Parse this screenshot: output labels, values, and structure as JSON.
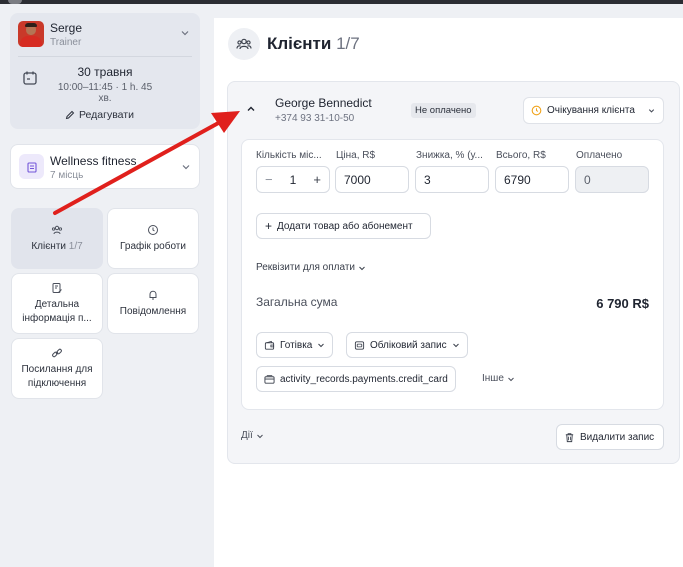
{
  "trainer": {
    "name": "Serge",
    "role": "Trainer",
    "date": "30 травня",
    "time": "10:00–11:45 · 1 h. 45 хв.",
    "edit_label": "Редагувати"
  },
  "gym": {
    "name": "Wellness fitness",
    "capacity": "7 місць"
  },
  "nav": {
    "clients_label": "Клієнти",
    "clients_count": "1/7",
    "schedule_label": "Графік роботи",
    "details_label_1": "Детальна",
    "details_label_2": "інформація п...",
    "notifications_label": "Повідомлення",
    "link_label_1": "Посилання для",
    "link_label_2": "підключення"
  },
  "page": {
    "title": "Клієнти",
    "count": "1/7"
  },
  "client": {
    "name": "George Bennedict",
    "phone": "+374 93 31-10-50",
    "payment_badge": "Не оплачено",
    "status": "Очікування клієнта",
    "columns": {
      "quantity": "Кількість міс...",
      "price": "Ціна, R$",
      "discount": "Знижка, % (у...",
      "total": "Всього, R$",
      "paid": "Оплачено"
    },
    "quantity": "1",
    "price": "7000",
    "discount": "3",
    "line_total": "6790",
    "paid": "0",
    "add_item_label": "Додати товар або абонемент",
    "requisites_label": "Реквізити для оплати",
    "grand_total_label": "Загальна сума",
    "grand_total_value": "6 790 R$",
    "payment_methods": {
      "cash": "Готівка",
      "account": "Обліковий запис",
      "credit": "activity_records.payments.credit_card",
      "other": "Інше"
    },
    "actions_label": "Дії",
    "delete_label": "Видалити запис"
  },
  "colors": {
    "annotation_arrow": "#e0201c",
    "status_icon": "#f0a31b",
    "gym_icon": "#7457d9"
  }
}
